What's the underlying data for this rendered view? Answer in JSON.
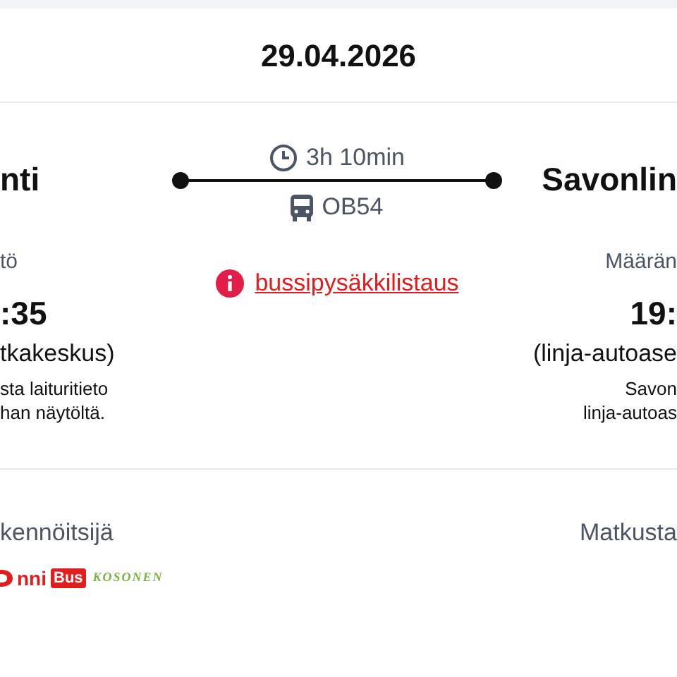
{
  "date": "29.04.2026",
  "departure": {
    "city": "nti",
    "label": "tö",
    "time": ":35",
    "place": "tkakeskus)",
    "note_lines": [
      "sta laituritieto",
      "han näytöltä."
    ]
  },
  "journey": {
    "duration": "3h 10min",
    "route": "OB54",
    "stop_list_link": "bussipysäkkilistaus"
  },
  "arrival": {
    "city": "Savonlin",
    "label": "Määrän",
    "time": "19:",
    "place": "(linja-autoase",
    "note_lines": [
      "Savon",
      "linja-autoas"
    ]
  },
  "operator": {
    "label": "kennöitsijä",
    "logo_parts": [
      "nni",
      "Bus",
      "KOSONEN"
    ]
  },
  "passenger_label": "Matkusta"
}
